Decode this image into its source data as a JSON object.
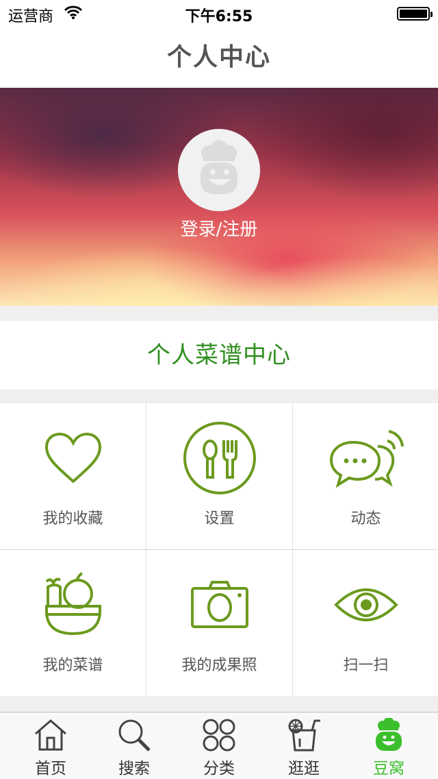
{
  "status_bar": {
    "carrier": "运营商",
    "time": "下午6:55"
  },
  "nav": {
    "title": "个人中心"
  },
  "profile": {
    "login_label": "登录/注册"
  },
  "recipe_center": {
    "label": "个人菜谱中心"
  },
  "grid": [
    {
      "label": "我的收藏",
      "icon": "heart-icon"
    },
    {
      "label": "设置",
      "icon": "utensils-icon"
    },
    {
      "label": "动态",
      "icon": "chat-bubbles-icon"
    },
    {
      "label": "我的菜谱",
      "icon": "vegetable-bowl-icon"
    },
    {
      "label": "我的成果照",
      "icon": "camera-icon"
    },
    {
      "label": "扫一扫",
      "icon": "eye-icon"
    }
  ],
  "tabs": [
    {
      "label": "首页",
      "icon": "home-icon",
      "active": false
    },
    {
      "label": "搜索",
      "icon": "search-icon",
      "active": false
    },
    {
      "label": "分类",
      "icon": "categories-icon",
      "active": false
    },
    {
      "label": "逛逛",
      "icon": "browse-drink-icon",
      "active": false
    },
    {
      "label": "豆窝",
      "icon": "chef-mascot-icon",
      "active": true
    }
  ],
  "colors": {
    "accent_green": "#2f8f1f",
    "icon_green": "#6b9a1e",
    "tab_active": "#3cbf2c"
  }
}
